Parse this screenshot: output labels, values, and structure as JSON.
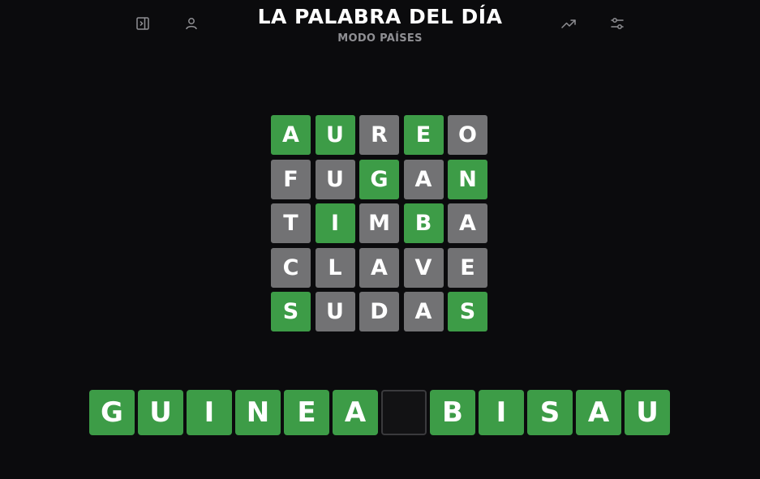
{
  "header": {
    "title": "LA PALABRA DEL DÍA",
    "subtitle": "MODO PAÍSES",
    "icons": [
      "sidebar-toggle-icon",
      "user-icon",
      "stats-trend-icon",
      "settings-sliders-icon"
    ]
  },
  "colors": {
    "correct": "#3d9c47",
    "absent": "#727274",
    "background": "#0b0b0d"
  },
  "board": {
    "rows": [
      [
        {
          "letter": "A",
          "state": "correct"
        },
        {
          "letter": "U",
          "state": "correct"
        },
        {
          "letter": "R",
          "state": "absent"
        },
        {
          "letter": "E",
          "state": "correct"
        },
        {
          "letter": "O",
          "state": "absent"
        }
      ],
      [
        {
          "letter": "F",
          "state": "absent"
        },
        {
          "letter": "U",
          "state": "absent"
        },
        {
          "letter": "G",
          "state": "correct"
        },
        {
          "letter": "A",
          "state": "absent"
        },
        {
          "letter": "N",
          "state": "correct"
        }
      ],
      [
        {
          "letter": "T",
          "state": "absent"
        },
        {
          "letter": "I",
          "state": "correct"
        },
        {
          "letter": "M",
          "state": "absent"
        },
        {
          "letter": "B",
          "state": "correct"
        },
        {
          "letter": "A",
          "state": "absent"
        }
      ],
      [
        {
          "letter": "C",
          "state": "absent"
        },
        {
          "letter": "L",
          "state": "absent"
        },
        {
          "letter": "A",
          "state": "absent"
        },
        {
          "letter": "V",
          "state": "absent"
        },
        {
          "letter": "E",
          "state": "absent"
        }
      ],
      [
        {
          "letter": "S",
          "state": "correct"
        },
        {
          "letter": "U",
          "state": "absent"
        },
        {
          "letter": "D",
          "state": "absent"
        },
        {
          "letter": "A",
          "state": "absent"
        },
        {
          "letter": "S",
          "state": "correct"
        }
      ]
    ]
  },
  "answer": {
    "letters": [
      "G",
      "U",
      "I",
      "N",
      "E",
      "A",
      " ",
      "B",
      "I",
      "S",
      "A",
      "U"
    ]
  }
}
